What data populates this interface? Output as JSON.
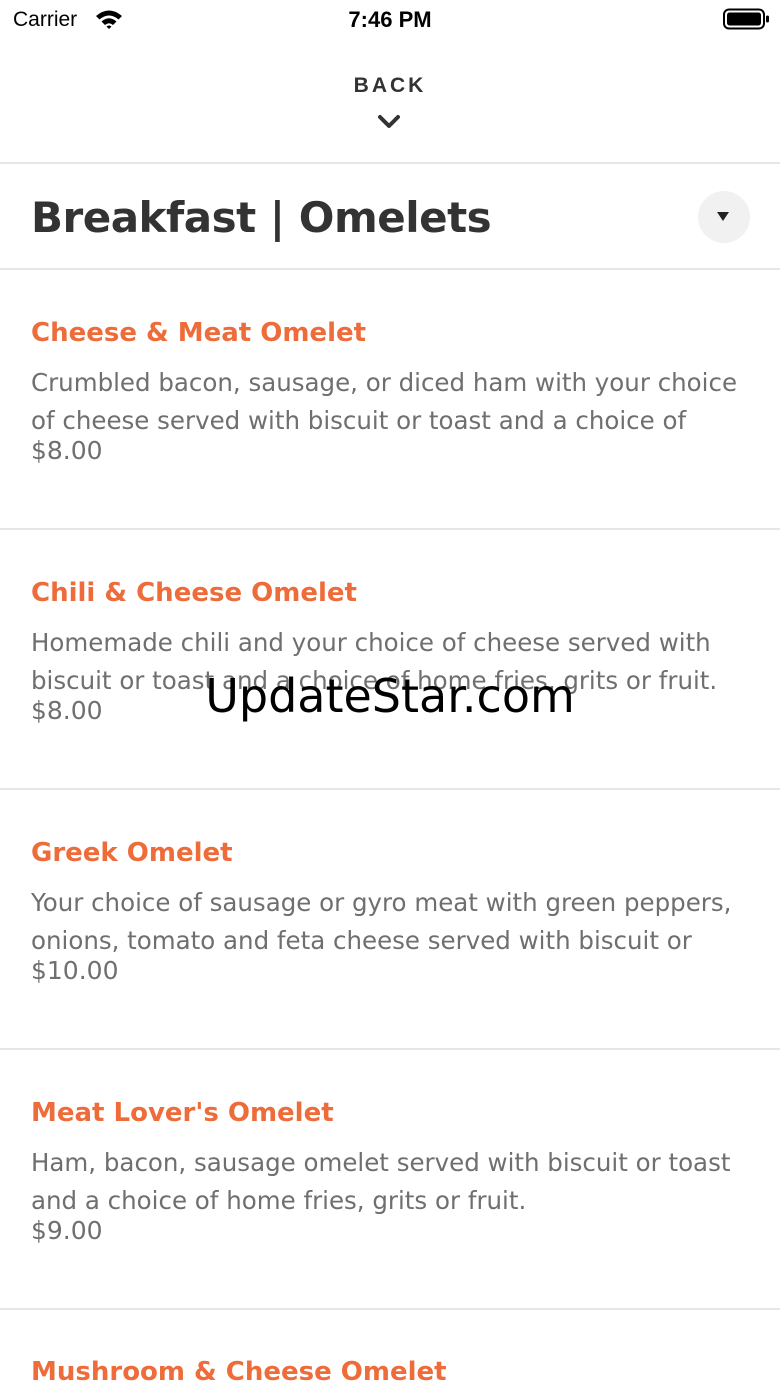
{
  "status_bar": {
    "carrier": "Carrier",
    "time": "7:46 PM",
    "icons": [
      "wifi-icon",
      "battery-icon"
    ]
  },
  "nav": {
    "back_label": "BACK",
    "icon": "chevron-down-icon"
  },
  "header": {
    "title": "Breakfast | Omelets",
    "dropdown_icon": "caret-down-icon"
  },
  "menu_items": [
    {
      "name": "Cheese & Meat Omelet",
      "description": "Crumbled bacon, sausage, or diced ham with your choice of cheese served with biscuit or toast and a choice of",
      "price": "$8.00"
    },
    {
      "name": "Chili & Cheese Omelet",
      "description": "Homemade chili and your choice of cheese served with biscuit or toast and a choice of home fries, grits or fruit.",
      "price": "$8.00"
    },
    {
      "name": "Greek Omelet",
      "description": "Your choice of sausage or gyro meat with green peppers, onions, tomato and feta cheese served with biscuit or",
      "price": "$10.00"
    },
    {
      "name": "Meat Lover's Omelet",
      "description": "Ham, bacon, sausage omelet served with biscuit or toast and a choice of home fries, grits or fruit.",
      "price": "$9.00"
    },
    {
      "name": "Mushroom & Cheese Omelet",
      "description": "",
      "price": ""
    }
  ],
  "watermark": "UpdateStar.com",
  "colors": {
    "accent": "#ee6b3a",
    "title": "#333333",
    "body_text": "#6f6f6f",
    "divider": "#e6e6e6"
  }
}
